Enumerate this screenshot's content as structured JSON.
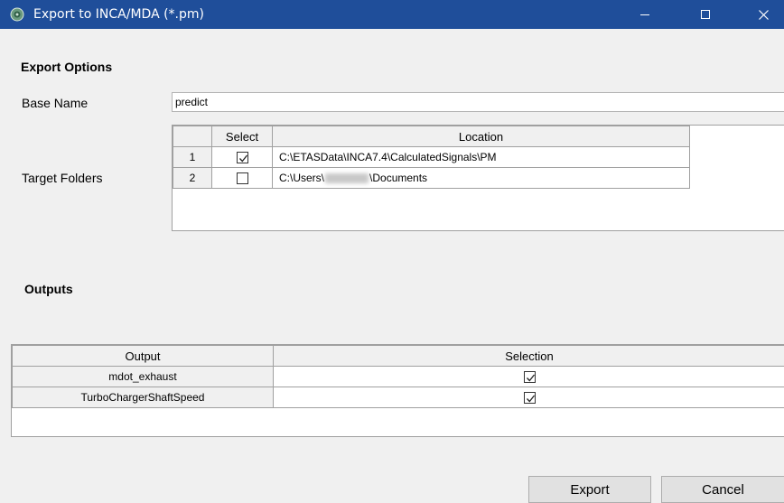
{
  "window": {
    "title": "Export to INCA/MDA (*.pm)",
    "minimize_glyph": "—",
    "close_glyph": "✕",
    "app_icon": "inca-app-icon"
  },
  "export_options": {
    "heading": "Export Options",
    "base_name_label": "Base Name",
    "base_name_value": "predict",
    "target_folders_label": "Target Folders",
    "folders_table": {
      "columns": [
        "Select",
        "Location"
      ],
      "rows": [
        {
          "index": "1",
          "selected": true,
          "location": "C:\\ETASData\\INCA7.4\\CalculatedSignals\\PM"
        },
        {
          "index": "2",
          "selected": false,
          "location_prefix": "C:\\Users\\",
          "location_suffix": "\\Documents"
        }
      ]
    }
  },
  "outputs": {
    "heading": "Outputs",
    "columns": [
      "Output",
      "Selection"
    ],
    "rows": [
      {
        "name": "mdot_exhaust",
        "selected": true
      },
      {
        "name": "TurboChargerShaftSpeed",
        "selected": true
      }
    ]
  },
  "buttons": {
    "export": "Export",
    "cancel": "Cancel"
  },
  "colors": {
    "titlebar": "#1f4e9a",
    "window_bg": "#f0f0f0",
    "grid_border": "#a0a0a0"
  }
}
